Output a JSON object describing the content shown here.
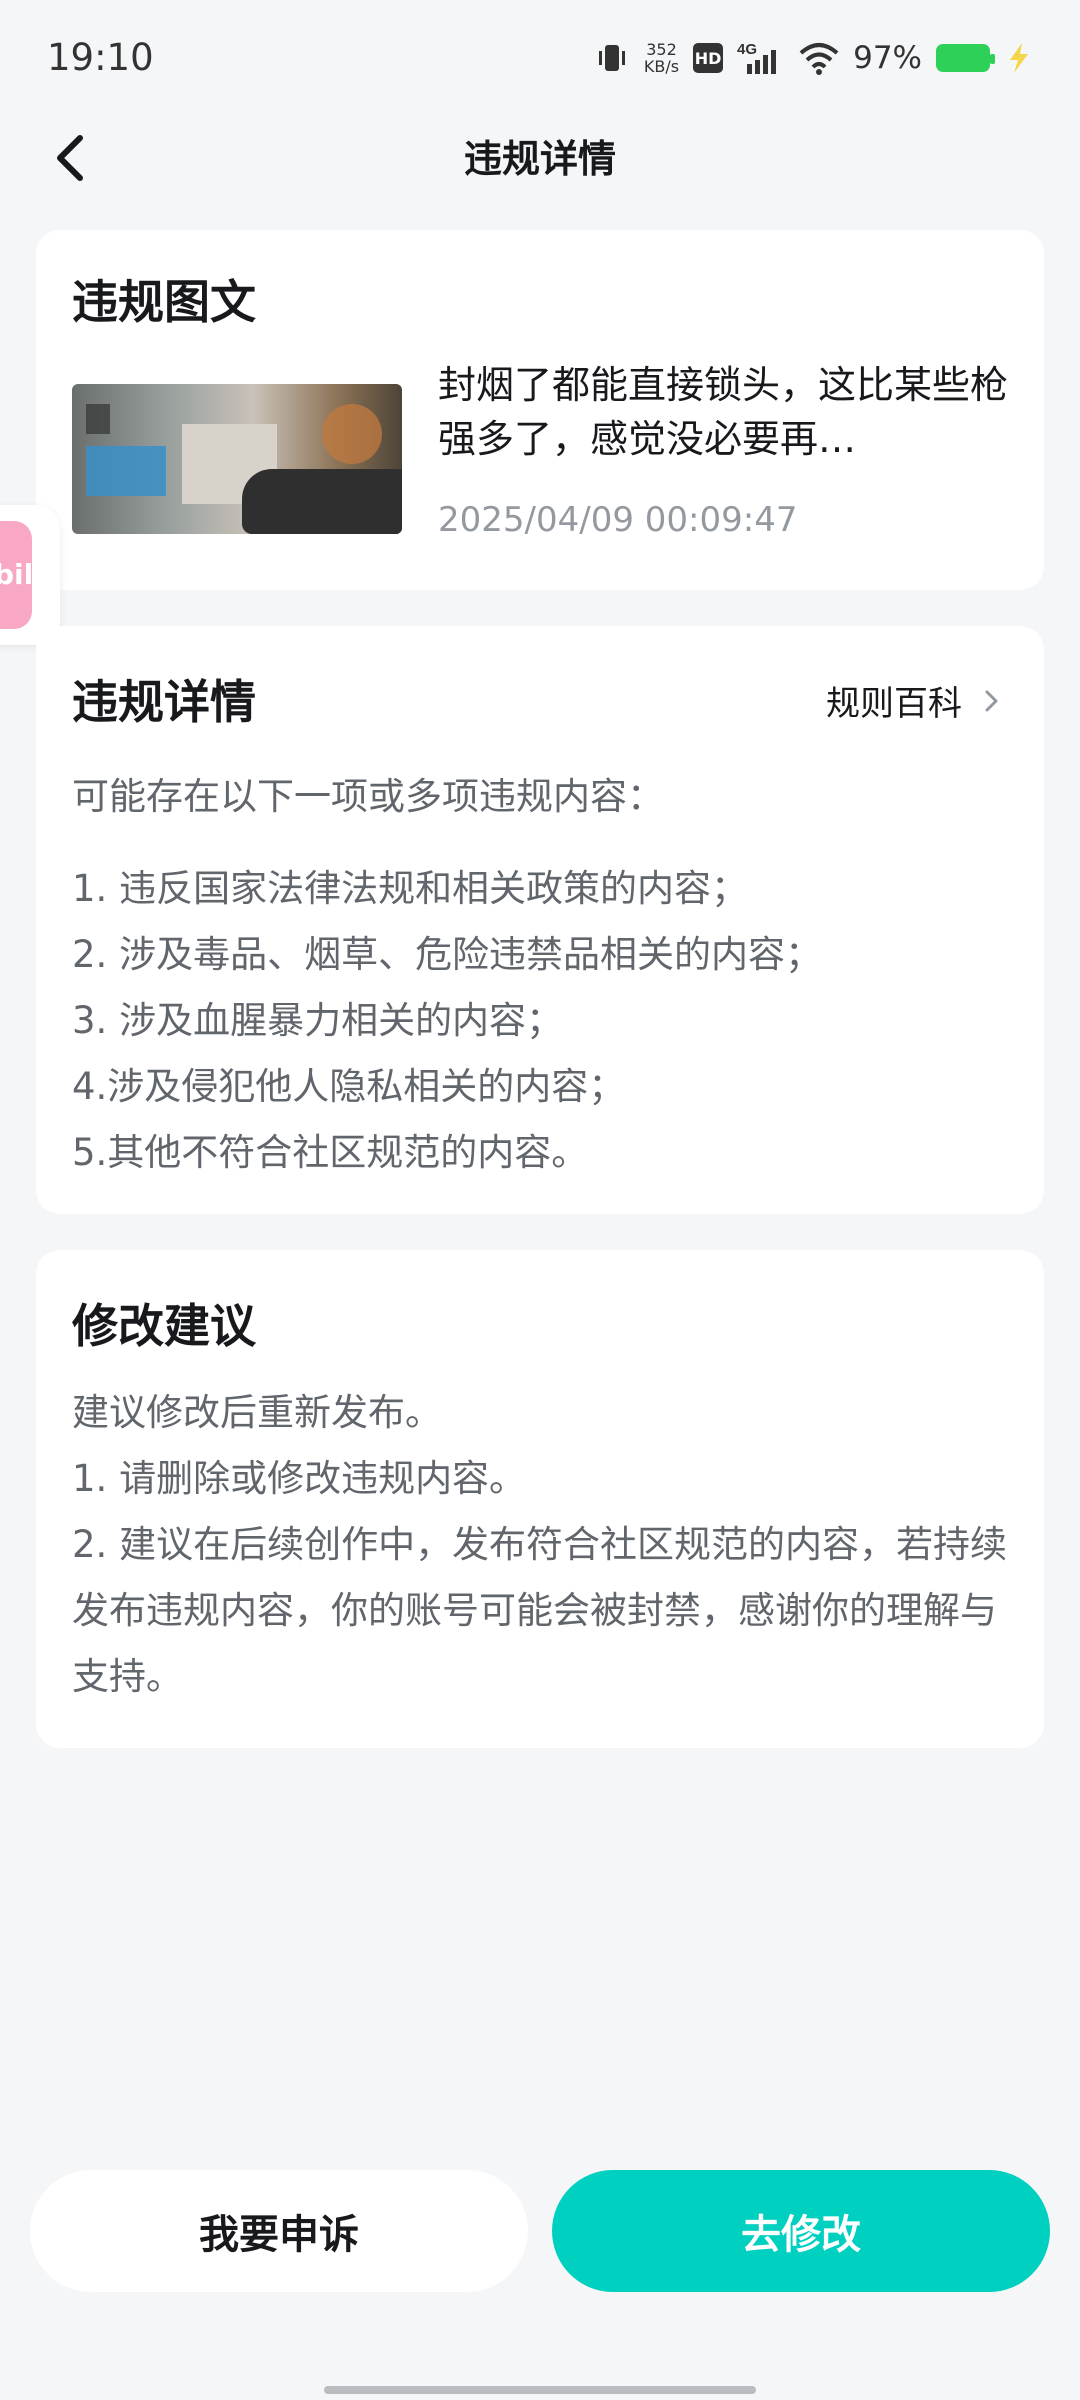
{
  "status_bar": {
    "time": "19:10",
    "net_speed_value": "352",
    "net_speed_unit": "KB/s",
    "hd": "HD",
    "network": "4G",
    "battery": "97%"
  },
  "nav": {
    "title": "违规详情"
  },
  "post_card": {
    "title": "违规图文",
    "text": "封烟了都能直接锁头，这比某些枪强多了，感觉没必要再…",
    "datetime": "2025/04/09 00:09:47"
  },
  "side_widget": {
    "label": "bili"
  },
  "violation_card": {
    "title": "违规详情",
    "rules_link": "规则百科",
    "intro": "可能存在以下一项或多项违规内容：",
    "items": [
      "1. 违反国家法律法规和相关政策的内容；",
      "2. 涉及毒品、烟草、危险违禁品相关的内容；",
      "3. 涉及血腥暴力相关的内容；",
      "4.涉及侵犯他人隐私相关的内容；",
      "5.其他不符合社区规范的内容。"
    ]
  },
  "advice_card": {
    "title": "修改建议",
    "lines": [
      "建议修改后重新发布。",
      "1. 请删除或修改违规内容。",
      "2. 建议在后续创作中，发布符合社区规范的内容，若持续发布违规内容，你的账号可能会被封禁，感谢你的理解与支持。"
    ]
  },
  "actions": {
    "appeal": "我要申诉",
    "edit": "去修改"
  },
  "colors": {
    "accent": "#00d0c0",
    "background": "#f5f6f8",
    "secondary_text": "#61666d",
    "date_text": "#9499a0"
  }
}
